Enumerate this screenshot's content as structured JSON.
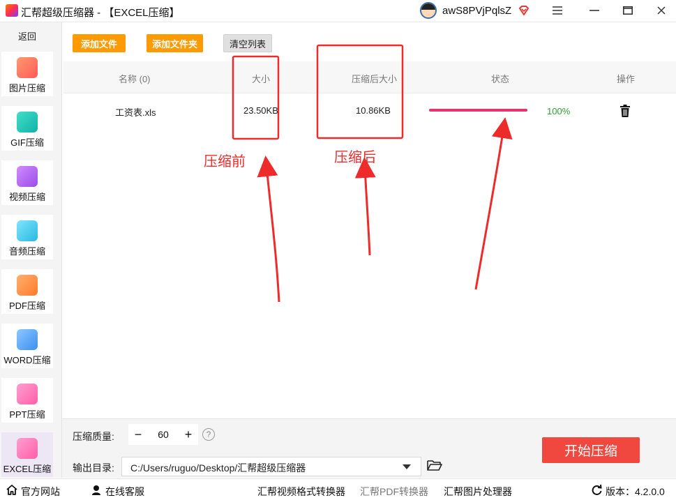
{
  "window": {
    "title": "汇帮超级压缩器  - 【EXCEL压缩】",
    "user_name": "awS8PVjPqlsZ"
  },
  "sidebar": {
    "back_label": "返回",
    "items": [
      {
        "label": "图片压缩",
        "icon": "image-icon",
        "color": "#ff6a5c"
      },
      {
        "label": "GIF压缩",
        "icon": "gif-icon",
        "color": "#19c3b3"
      },
      {
        "label": "视频压缩",
        "icon": "video-icon",
        "color": "#b05cf0"
      },
      {
        "label": "音频压缩",
        "icon": "audio-icon",
        "color": "#33c6e8"
      },
      {
        "label": "PDF压缩",
        "icon": "pdf-icon",
        "color": "#ff8a3d"
      },
      {
        "label": "WORD压缩",
        "icon": "word-icon",
        "color": "#3d9bf0"
      },
      {
        "label": "PPT压缩",
        "icon": "ppt-icon",
        "color": "#ff6bb5"
      },
      {
        "label": "EXCEL压缩",
        "icon": "excel-icon",
        "color": "#ff6bb5"
      }
    ]
  },
  "toolbar": {
    "add_file": "添加文件",
    "add_folder": "添加文件夹",
    "clear_list": "清空列表"
  },
  "table": {
    "columns": {
      "name": "名称 (0)",
      "size": "大小",
      "compressed_size": "压缩后大小",
      "status": "状态",
      "action": "操作"
    },
    "rows": [
      {
        "name": "工资表.xls",
        "size": "23.50KB",
        "compressed_size": "10.86KB",
        "progress": 1.0,
        "status": "100%"
      }
    ]
  },
  "annotations": {
    "before_label": "压缩前",
    "after_label": "压缩后",
    "color": "#ee2b2b"
  },
  "settings": {
    "quality_label": "压缩质量:",
    "quality_value": "60",
    "quality_minus": "−",
    "quality_plus": "+",
    "help": "?",
    "output_label": "输出目录:",
    "output_path": "C:/Users/ruguo/Desktop/汇帮超级压缩器",
    "start_button": "开始压缩"
  },
  "footer": {
    "website": "官方网站",
    "support": "在线客服",
    "link1": "汇帮视频格式转换器",
    "link2": "汇帮PDF转换器",
    "link3": "汇帮图片处理器",
    "version": "版本：4.2.0.0"
  },
  "colors": {
    "accent_orange": "#ff9a00",
    "start_red": "#f0483e",
    "progress_pink": "#e8336e",
    "status_green": "#2ea02e"
  }
}
